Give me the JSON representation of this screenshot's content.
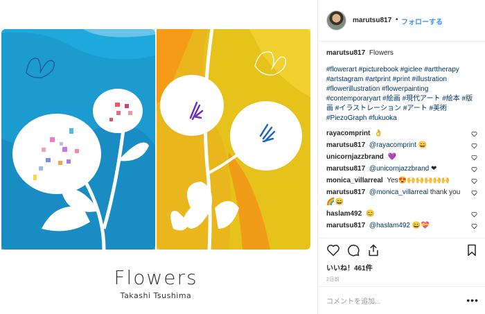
{
  "artwork": {
    "title": "Flowers",
    "author": "Takashi Tsushima"
  },
  "header": {
    "username": "marutsu817",
    "separator": "•",
    "follow_label": "フォローする"
  },
  "caption": {
    "username": "marutsu817",
    "text": "Flowers",
    "hashtags": "#flowerart #picturebook #giclee #arttherapy #artstagram #artprint #print #illustration #flowerillustration #flowerpainting #contemporaryart #絵画 #現代アート #絵本 #版画 #イラストレーション #アート #美術 #PiezoGraph #fukuoka"
  },
  "comments": [
    {
      "user": "rayacomprint",
      "mention": "",
      "text": "👌"
    },
    {
      "user": "marutsu817",
      "mention": "@rayacomprint",
      "text": "😄"
    },
    {
      "user": "unicornjazzbrand",
      "mention": "",
      "text": "💜"
    },
    {
      "user": "marutsu817",
      "mention": "@unicornjazzbrand",
      "text": "❤"
    },
    {
      "user": "monica_villarreal",
      "mention": "",
      "text": "Yes😍🙌🙌🙌🙌🙌"
    },
    {
      "user": "marutsu817",
      "mention": "@monica_villarreal",
      "text": "thank you 🌈😄"
    },
    {
      "user": "haslam492",
      "mention": "",
      "text": "😊"
    },
    {
      "user": "marutsu817",
      "mention": "@haslam492",
      "text": "😄💝"
    }
  ],
  "icons": {
    "like": "heart-icon",
    "comment": "comment-bubble-icon",
    "share": "share-icon",
    "save": "bookmark-icon",
    "comment_like": "heart-icon",
    "more": "more-options-icon"
  },
  "likes": {
    "label": "いいね！461件"
  },
  "date": {
    "text": "2日前"
  },
  "add_comment": {
    "placeholder": "コメントを追加...",
    "more_label": "•••"
  },
  "colors": {
    "link": "#003569",
    "follow": "#3897f0",
    "art_blue": "#1aa7db",
    "art_yellow": "#e9c512",
    "art_orange": "#f2a21a"
  }
}
